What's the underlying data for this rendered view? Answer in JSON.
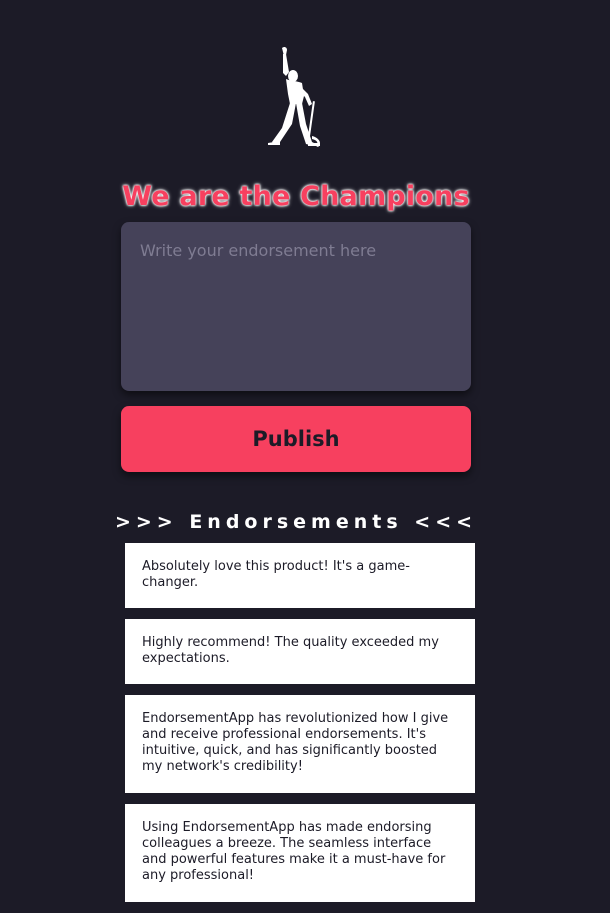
{
  "header": {
    "logo_icon": "silhouette-singer-icon",
    "title": "We are the Champions"
  },
  "form": {
    "placeholder": "Write your endorsement here",
    "value": "",
    "publish_label": "Publish"
  },
  "endorsements": {
    "heading": ">>> Endorsements <<<",
    "items": [
      "Absolutely love this product! It's a game-changer.",
      "Highly recommend! The quality exceeded my expectations.",
      "EndorsementApp has revolutionized how I give and receive professional endorsements. It's intuitive, quick, and has significantly boosted my network's credibility!",
      "Using EndorsementApp has made endorsing colleagues a breeze. The seamless interface and powerful features make it a must-have for any professional!"
    ]
  },
  "colors": {
    "background": "#1c1b27",
    "accent": "#f7405f",
    "input_bg": "#454259",
    "card_bg": "#ffffff"
  }
}
